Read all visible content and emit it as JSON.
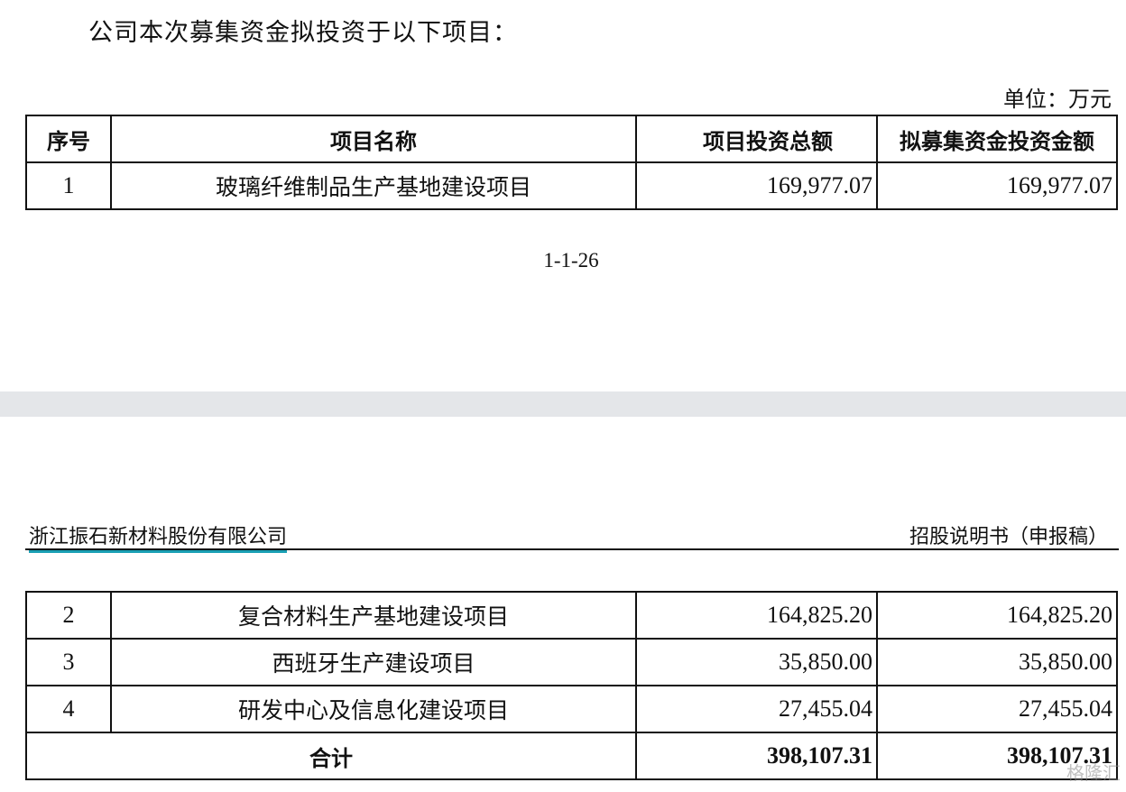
{
  "intro": "公司本次募集资金拟投资于以下项目：",
  "unit": "单位：万元",
  "table": {
    "headers": [
      "序号",
      "项目名称",
      "项目投资总额",
      "拟募集资金投资金额"
    ],
    "rows": [
      [
        "1",
        "玻璃纤维制品生产基地建设项目",
        "169,977.07",
        "169,977.07"
      ],
      [
        "2",
        "复合材料生产基地建设项目",
        "164,825.20",
        "164,825.20"
      ],
      [
        "3",
        "西班牙生产建设项目",
        "35,850.00",
        "35,850.00"
      ],
      [
        "4",
        "研发中心及信息化建设项目",
        "27,455.04",
        "27,455.04"
      ]
    ],
    "total": [
      "合计",
      "398,107.31",
      "398,107.31"
    ]
  },
  "page_number": "1-1-26",
  "header": {
    "company": "浙江振石新材料股份有限公司",
    "doc_type": "招股说明书（申报稿）"
  },
  "watermark": "格隆汇",
  "colors": {
    "company_underline": "#1aa0b5",
    "page_gap": "#e4e6e9"
  }
}
